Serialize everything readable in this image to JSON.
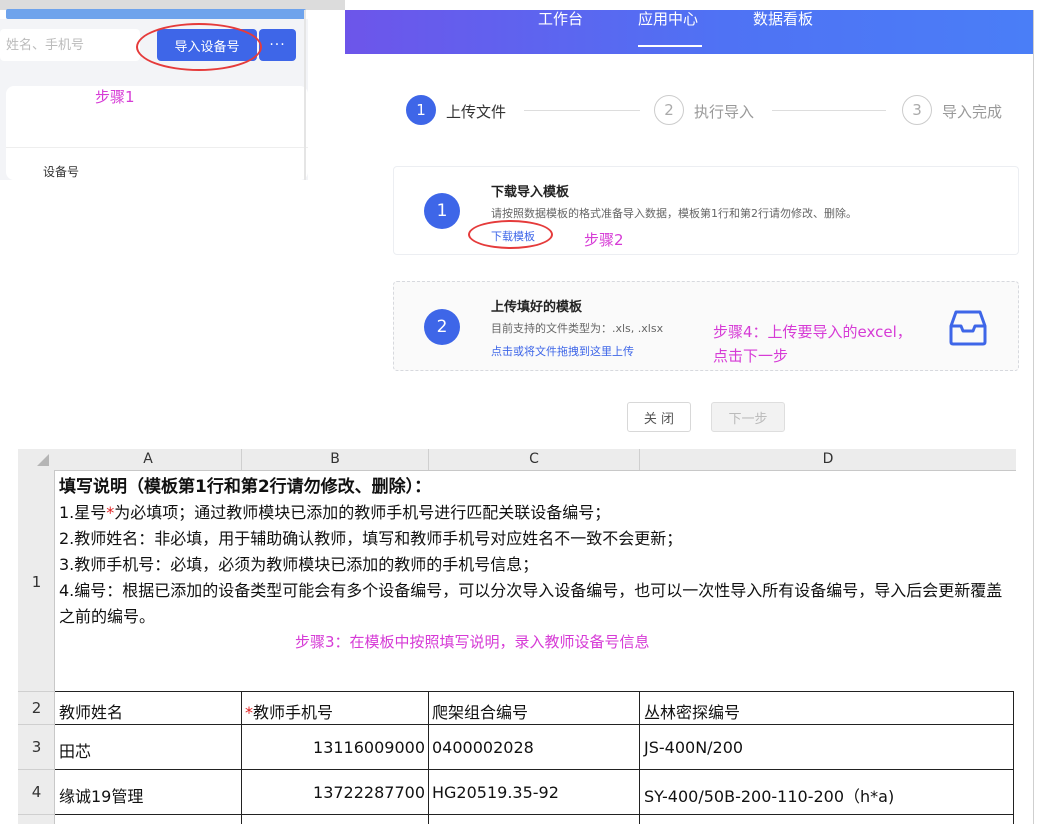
{
  "left_panel": {
    "search_placeholder": "姓名、手机号",
    "import_button": "导入设备号",
    "more_button": "···",
    "annotation_step1": "步骤1",
    "table_column": "设备号"
  },
  "nav": {
    "items": [
      "工作台",
      "应用中心",
      "数据看板"
    ],
    "active": "应用中心"
  },
  "steps": [
    {
      "num": "1",
      "label": "上传文件",
      "state": "active"
    },
    {
      "num": "2",
      "label": "执行导入",
      "state": "idle"
    },
    {
      "num": "3",
      "label": "导入完成",
      "state": "idle"
    }
  ],
  "card1": {
    "num": "1",
    "title": "下载导入模板",
    "desc": "请按照数据模板的格式准备导入数据，模板第1行和第2行请勿修改、删除。",
    "link": "下载模板",
    "annotation": "步骤2"
  },
  "card2": {
    "num": "2",
    "title": "上传填好的模板",
    "desc": "目前支持的文件类型为：.xls, .xlsx",
    "link": "点击或将文件拖拽到这里上传",
    "annotation_line1": "步骤4：上传要导入的excel，",
    "annotation_line2": "点击下一步",
    "icon": "inbox-icon"
  },
  "buttons": {
    "close": "关 闭",
    "next": "下一步"
  },
  "sheet": {
    "columns": [
      "A",
      "B",
      "C",
      "D"
    ],
    "row_numbers": [
      "1",
      "2",
      "3",
      "4"
    ],
    "instructions": {
      "title": "填写说明（模板第1行和第2行请勿修改、删除）：",
      "line1_pre": "1.星号",
      "line1_star": "*",
      "line1_post": "为必填项；通过教师模块已添加的教师手机号进行匹配关联设备编号；",
      "line2": "2.教师姓名：非必填，用于辅助确认教师，填写和教师手机号对应姓名不一致不会更新；",
      "line3": "3.教师手机号：必填，必须为教师模块已添加的教师的手机号信息；",
      "line4": "4.编号：根据已添加的设备类型可能会有多个设备编号，可以分次导入设备编号，也可以一次性导入所有设备编号，导入后会更新覆盖之前的编号。"
    },
    "annotation_step3": "步骤3：在模板中按照填写说明，录入教师设备号信息",
    "headers": {
      "teacher_name": "教师姓名",
      "phone_star": "*",
      "phone": "教师手机号",
      "climb": "爬架组合编号",
      "jungle": "丛林密探编号"
    },
    "rows": [
      {
        "name": "田芯",
        "phone": "13116009000",
        "climb": "0400002028",
        "jungle": "JS-400N/200"
      },
      {
        "name": "缘诚19管理",
        "phone": "13722287700",
        "climb": "HG20519.35-92",
        "jungle": "SY-400/50B-200-110-200（h*a)"
      }
    ]
  }
}
